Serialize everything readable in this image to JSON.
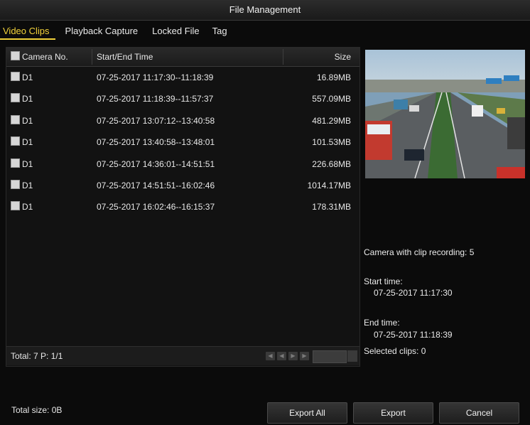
{
  "window": {
    "title": "File Management"
  },
  "tabs": [
    {
      "label": "Video Clips"
    },
    {
      "label": "Playback Capture"
    },
    {
      "label": "Locked File"
    },
    {
      "label": "Tag"
    }
  ],
  "table": {
    "headers": {
      "camera": "Camera No.",
      "time": "Start/End Time",
      "size": "Size"
    },
    "rows": [
      {
        "camera": "D1",
        "time": "07-25-2017 11:17:30--11:18:39",
        "size": "16.89MB"
      },
      {
        "camera": "D1",
        "time": "07-25-2017 11:18:39--11:57:37",
        "size": "557.09MB"
      },
      {
        "camera": "D1",
        "time": "07-25-2017 13:07:12--13:40:58",
        "size": "481.29MB"
      },
      {
        "camera": "D1",
        "time": "07-25-2017 13:40:58--13:48:01",
        "size": "101.53MB"
      },
      {
        "camera": "D1",
        "time": "07-25-2017 14:36:01--14:51:51",
        "size": "226.68MB"
      },
      {
        "camera": "D1",
        "time": "07-25-2017 14:51:51--16:02:46",
        "size": "1014.17MB"
      },
      {
        "camera": "D1",
        "time": "07-25-2017 16:02:46--16:15:37",
        "size": "178.31MB"
      }
    ]
  },
  "pager": {
    "total": "Total: 7  P: 1/1"
  },
  "details": {
    "clips_recording": "Camera with clip recording: 5",
    "start_label": "Start time:",
    "start_value": "07-25-2017 11:17:30",
    "end_label": "End time:",
    "end_value": "07-25-2017 11:18:39",
    "selected": "Selected clips: 0"
  },
  "footer": {
    "total_size": "Total size: 0B",
    "export_all": "Export All",
    "export": "Export",
    "cancel": "Cancel"
  }
}
